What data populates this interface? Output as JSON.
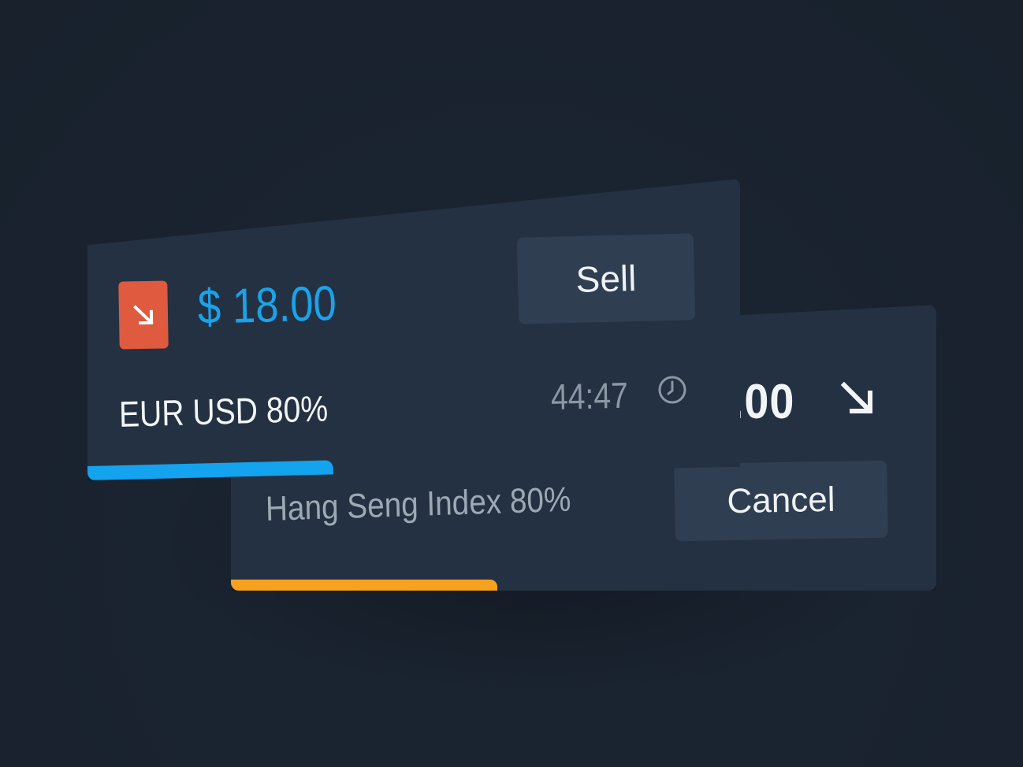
{
  "colors": {
    "background": "#1a2330",
    "card": "#243142",
    "button": "#2f3e51",
    "accent_blue": "#14a3ee",
    "accent_orange": "#f7a11f",
    "sell_red": "#df5a3e"
  },
  "front_card": {
    "direction_icon": "arrow-down-right-icon",
    "amount": "$ 18.00",
    "sell_label": "Sell",
    "asset_label": "EUR USD 80%",
    "timer": "44:47",
    "timer_icon": "clock-icon"
  },
  "back_card": {
    "amount": ".00",
    "direction_icon": "arrow-down-right-icon",
    "asset_label": "Hang Seng Index 80%",
    "cancel_label": "Cancel"
  }
}
